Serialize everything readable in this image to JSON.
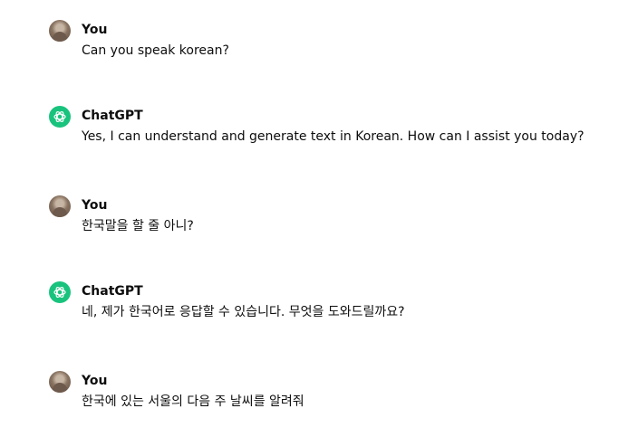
{
  "conversation": {
    "messages": [
      {
        "author": "You",
        "role": "user",
        "avatar_icon": "user-avatar-photo",
        "text": "Can you speak korean?"
      },
      {
        "author": "ChatGPT",
        "role": "assistant",
        "avatar_icon": "openai-logo-icon",
        "text": "Yes, I can understand and generate text in Korean. How can I assist you today?"
      },
      {
        "author": "You",
        "role": "user",
        "avatar_icon": "user-avatar-photo",
        "text": "한국말을 할 줄 아니?"
      },
      {
        "author": "ChatGPT",
        "role": "assistant",
        "avatar_icon": "openai-logo-icon",
        "text": "네, 제가 한국어로 응답할 수 있습니다. 무엇을 도와드릴까요?"
      },
      {
        "author": "You",
        "role": "user",
        "avatar_icon": "user-avatar-photo",
        "text": "한국에 있는 서울의 다음 주 날씨를 알려줘"
      }
    ]
  },
  "colors": {
    "assistant_avatar_bg": "#19c37d",
    "text": "#0d0d0d",
    "background": "#ffffff"
  }
}
